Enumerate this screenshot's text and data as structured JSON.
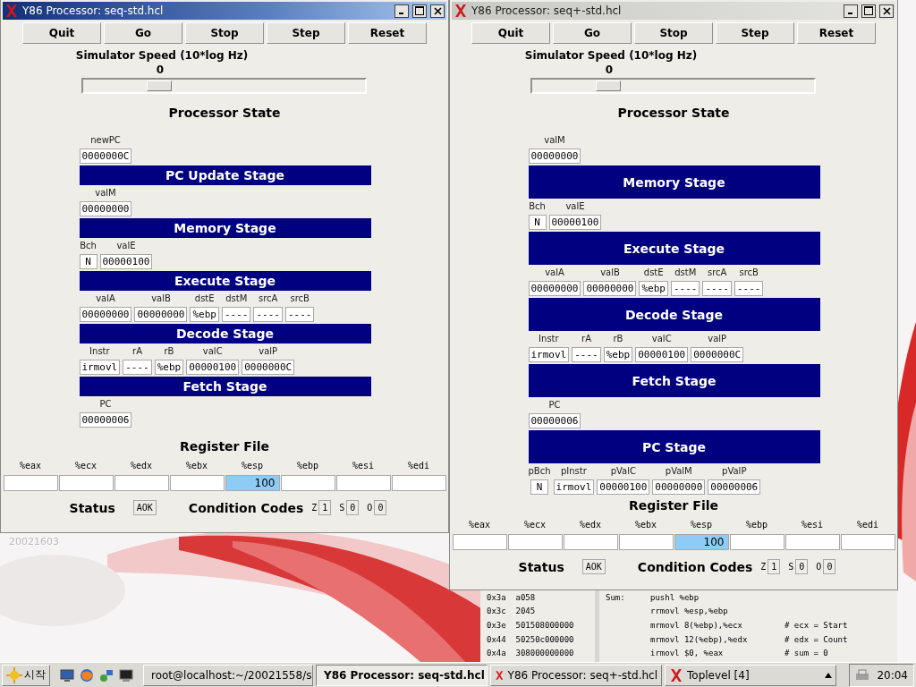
{
  "desktop": {
    "icon_label": "20021603"
  },
  "windows": [
    {
      "title": "Y86 Processor: seq-std.hcl",
      "active": true,
      "buttons": [
        "Quit",
        "Go",
        "Stop",
        "Step",
        "Reset"
      ],
      "speed": {
        "label": "Simulator Speed (10*log Hz)",
        "value": "0",
        "level": 0.25
      },
      "state_title": "Processor State",
      "sections": [
        {
          "kind": "fields",
          "fields": [
            {
              "label": "newPC",
              "value": "0000000C"
            }
          ]
        },
        {
          "kind": "stage",
          "title": "PC Update Stage"
        },
        {
          "kind": "fields",
          "fields": [
            {
              "label": "valM",
              "value": "00000000"
            }
          ]
        },
        {
          "kind": "stage",
          "title": "Memory Stage"
        },
        {
          "kind": "fields",
          "fields": [
            {
              "label": "Bch",
              "value": "N"
            },
            {
              "label": "valE",
              "value": "00000100"
            }
          ]
        },
        {
          "kind": "stage",
          "title": "Execute Stage"
        },
        {
          "kind": "fields",
          "fields": [
            {
              "label": "valA",
              "value": "00000000"
            },
            {
              "label": "valB",
              "value": "00000000"
            },
            {
              "label": "dstE",
              "value": "%ebp"
            },
            {
              "label": "dstM",
              "value": "----"
            },
            {
              "label": "srcA",
              "value": "----"
            },
            {
              "label": "srcB",
              "value": "----"
            }
          ]
        },
        {
          "kind": "stage",
          "title": "Decode Stage"
        },
        {
          "kind": "fields",
          "fields": [
            {
              "label": "Instr",
              "value": "irmovl"
            },
            {
              "label": "rA",
              "value": "----"
            },
            {
              "label": "rB",
              "value": "%ebp"
            },
            {
              "label": "valC",
              "value": "00000100"
            },
            {
              "label": "valP",
              "value": "0000000C"
            }
          ]
        },
        {
          "kind": "stage",
          "title": "Fetch Stage"
        },
        {
          "kind": "fields",
          "fields": [
            {
              "label": "PC",
              "value": "00000006"
            }
          ]
        }
      ],
      "register_title": "Register File",
      "registers": [
        {
          "name": "%eax",
          "highlighted": false
        },
        {
          "name": "%ecx",
          "highlighted": false
        },
        {
          "name": "%edx",
          "highlighted": false
        },
        {
          "name": "%ebx",
          "highlighted": false
        },
        {
          "name": "%esp",
          "value": "100",
          "highlighted": true
        },
        {
          "name": "%ebp",
          "highlighted": false
        },
        {
          "name": "%esi",
          "highlighted": false
        },
        {
          "name": "%edi",
          "highlighted": false
        }
      ],
      "status": {
        "label": "Status",
        "value": "AOK"
      },
      "condition_codes": {
        "label": "Condition Codes",
        "flags": [
          {
            "name": "Z",
            "value": "1"
          },
          {
            "name": "S",
            "value": "0"
          },
          {
            "name": "O",
            "value": "0"
          }
        ]
      }
    },
    {
      "title": "Y86 Processor: seq+-std.hcl",
      "active": false,
      "buttons": [
        "Quit",
        "Go",
        "Stop",
        "Step",
        "Reset"
      ],
      "speed": {
        "label": "Simulator Speed (10*log Hz)",
        "value": "0",
        "level": 0.25
      },
      "state_title": "Processor State",
      "sections": [
        {
          "kind": "fields",
          "fields": [
            {
              "label": "valM",
              "value": "00000000"
            }
          ]
        },
        {
          "kind": "stage",
          "title": "Memory Stage"
        },
        {
          "kind": "fields",
          "fields": [
            {
              "label": "Bch",
              "value": "N"
            },
            {
              "label": "valE",
              "value": "00000100"
            }
          ]
        },
        {
          "kind": "stage",
          "title": "Execute Stage"
        },
        {
          "kind": "fields",
          "fields": [
            {
              "label": "valA",
              "value": "00000000"
            },
            {
              "label": "valB",
              "value": "00000000"
            },
            {
              "label": "dstE",
              "value": "%ebp"
            },
            {
              "label": "dstM",
              "value": "----"
            },
            {
              "label": "srcA",
              "value": "----"
            },
            {
              "label": "srcB",
              "value": "----"
            }
          ]
        },
        {
          "kind": "stage",
          "title": "Decode Stage"
        },
        {
          "kind": "fields",
          "fields": [
            {
              "label": "Instr",
              "value": "irmovl"
            },
            {
              "label": "rA",
              "value": "----"
            },
            {
              "label": "rB",
              "value": "%ebp"
            },
            {
              "label": "valC",
              "value": "00000100"
            },
            {
              "label": "valP",
              "value": "0000000C"
            }
          ]
        },
        {
          "kind": "stage",
          "title": "Fetch Stage"
        },
        {
          "kind": "fields",
          "fields": [
            {
              "label": "PC",
              "value": "00000006"
            }
          ]
        },
        {
          "kind": "stage",
          "title": "PC Stage"
        },
        {
          "kind": "fields",
          "fields": [
            {
              "label": "pBch",
              "value": "N"
            },
            {
              "label": "pInstr",
              "value": "irmovl"
            },
            {
              "label": "pValC",
              "value": "00000100"
            },
            {
              "label": "pValM",
              "value": "00000000"
            },
            {
              "label": "pValP",
              "value": "00000006"
            }
          ]
        }
      ],
      "register_title": "Register File",
      "registers": [
        {
          "name": "%eax",
          "highlighted": false
        },
        {
          "name": "%ecx",
          "highlighted": false
        },
        {
          "name": "%edx",
          "highlighted": false
        },
        {
          "name": "%ebx",
          "highlighted": false
        },
        {
          "name": "%esp",
          "value": "100",
          "highlighted": true
        },
        {
          "name": "%ebp",
          "highlighted": false
        },
        {
          "name": "%esi",
          "highlighted": false
        },
        {
          "name": "%edi",
          "highlighted": false
        }
      ],
      "status": {
        "label": "Status",
        "value": "AOK"
      },
      "condition_codes": {
        "label": "Condition Codes",
        "flags": [
          {
            "name": "Z",
            "value": "1"
          },
          {
            "name": "S",
            "value": "0"
          },
          {
            "name": "O",
            "value": "0"
          }
        ]
      }
    }
  ],
  "code_window": {
    "memory": [
      {
        "address": "0x3a",
        "bytes": "a058"
      },
      {
        "address": "0x3c",
        "bytes": "2045"
      },
      {
        "address": "0x3e",
        "bytes": "501508000000"
      },
      {
        "address": "0x44",
        "bytes": "50250c000000"
      },
      {
        "address": "0x4a",
        "bytes": "308000000000"
      }
    ],
    "source": [
      {
        "label": "Sum:",
        "code": "pushl %ebp"
      },
      {
        "code": "rrmovl %esp,%ebp"
      },
      {
        "code": "mrmovl 8(%ebp),%ecx",
        "comment": "# ecx = Start"
      },
      {
        "code": "mrmovl 12(%ebp),%edx",
        "comment": "# edx = Count"
      },
      {
        "code": "irmovl $0, %eax",
        "comment": "# sum = 0"
      }
    ]
  },
  "taskbar": {
    "start": "시작",
    "tasks": [
      {
        "kind": "terminal",
        "label": "root@localhost:~/20021558/s",
        "active": false
      },
      {
        "kind": "x",
        "label": "Y86 Processor: seq-std.hcl",
        "active": true
      },
      {
        "kind": "x",
        "label": "Y86 Processor: seq+-std.hcl",
        "active": false
      },
      {
        "kind": "x",
        "label": "Toplevel [4]",
        "active": false
      }
    ],
    "clock": "20:04"
  }
}
